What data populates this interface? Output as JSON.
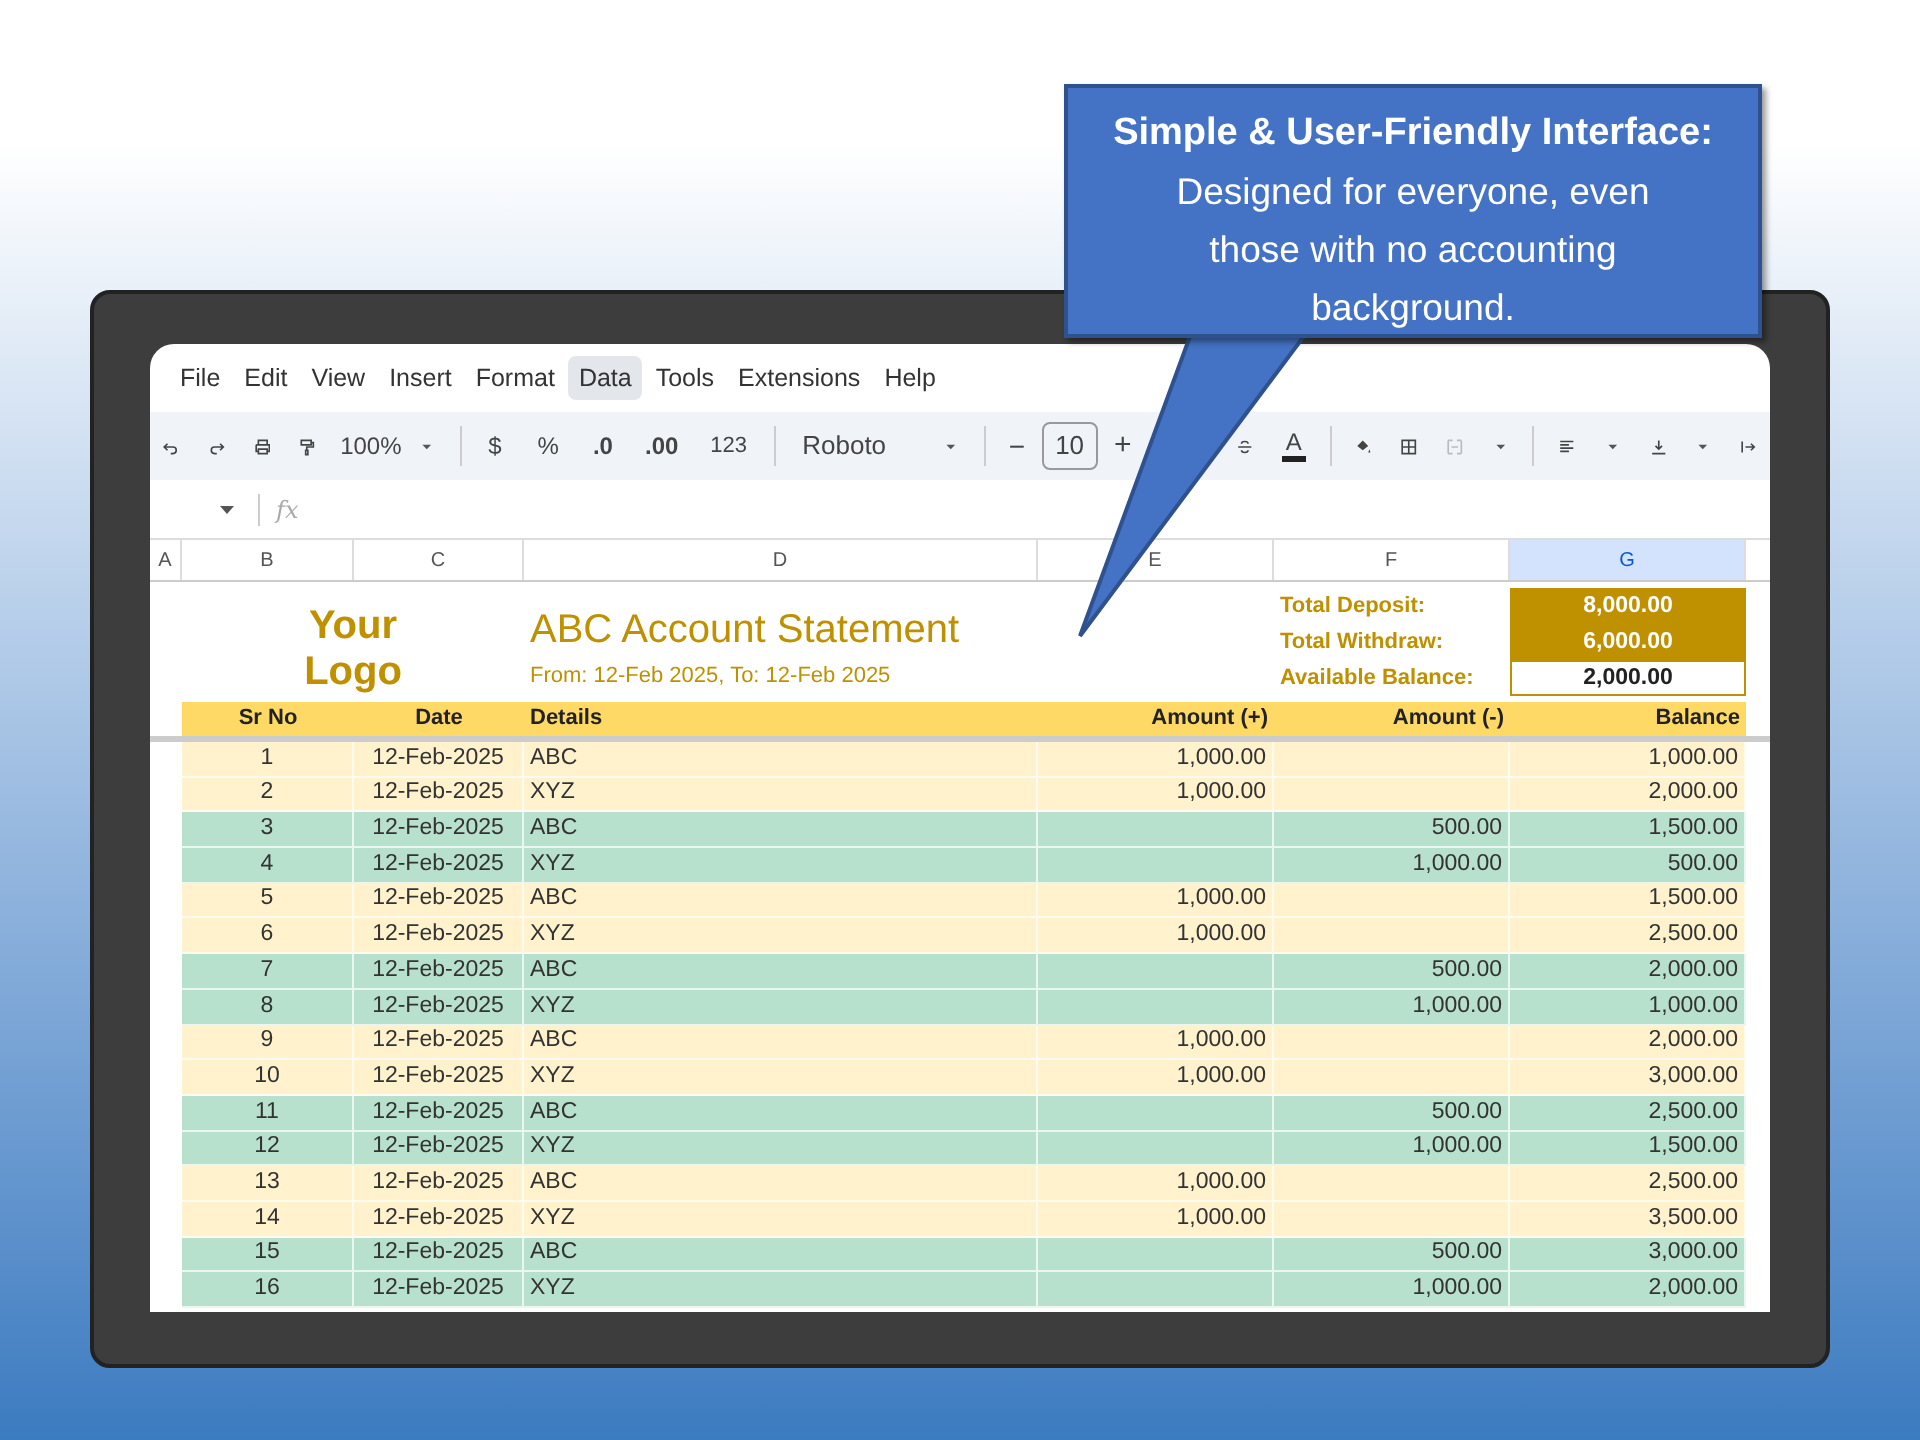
{
  "callout": {
    "title": "Simple & User-Friendly Interface:",
    "body": "Designed for everyone, even those with no accounting background."
  },
  "menu": [
    {
      "label": "File",
      "selected": false
    },
    {
      "label": "Edit",
      "selected": false
    },
    {
      "label": "View",
      "selected": false
    },
    {
      "label": "Insert",
      "selected": false
    },
    {
      "label": "Format",
      "selected": false
    },
    {
      "label": "Data",
      "selected": true
    },
    {
      "label": "Tools",
      "selected": false
    },
    {
      "label": "Extensions",
      "selected": false
    },
    {
      "label": "Help",
      "selected": false
    }
  ],
  "toolbar": {
    "zoom": "100%",
    "currency": "$",
    "percent": "%",
    "decrease_decimal": ".0",
    "increase_decimal": ".00",
    "number_format": "123",
    "font": "Roboto",
    "font_size_decrease": "−",
    "font_size": "10",
    "font_size_increase": "+",
    "text_color": "A"
  },
  "formula_bar": {
    "label": "fx"
  },
  "columns": [
    {
      "label": "A",
      "selected": false
    },
    {
      "label": "B",
      "selected": false
    },
    {
      "label": "C",
      "selected": false
    },
    {
      "label": "D",
      "selected": false
    },
    {
      "label": "E",
      "selected": false
    },
    {
      "label": "F",
      "selected": false
    },
    {
      "label": "G",
      "selected": true
    }
  ],
  "sheet": {
    "logo": "Your Logo",
    "title": "ABC Account Statement",
    "subtitle": "From: 12-Feb 2025, To: 12-Feb 2025",
    "summary": [
      {
        "label": "Total Deposit:",
        "value": "8,000.00",
        "highlighted": true
      },
      {
        "label": "Total Withdraw:",
        "value": "6,000.00",
        "highlighted": true
      },
      {
        "label": "Available Balance:",
        "value": "2,000.00",
        "highlighted": false
      }
    ],
    "headers": [
      "Sr No",
      "Date",
      "Details",
      "Amount (+)",
      "Amount (-)",
      "Balance"
    ],
    "rows": [
      {
        "sr": "1",
        "date": "12-Feb-2025",
        "details": "ABC",
        "plus": "1,000.00",
        "minus": "",
        "balance": "1,000.00",
        "color": "#fff2cc"
      },
      {
        "sr": "2",
        "date": "12-Feb-2025",
        "details": "XYZ",
        "plus": "1,000.00",
        "minus": "",
        "balance": "2,000.00",
        "color": "#fff2cc"
      },
      {
        "sr": "3",
        "date": "12-Feb-2025",
        "details": "ABC",
        "plus": "",
        "minus": "500.00",
        "balance": "1,500.00",
        "color": "#b7e1cd"
      },
      {
        "sr": "4",
        "date": "12-Feb-2025",
        "details": "XYZ",
        "plus": "",
        "minus": "1,000.00",
        "balance": "500.00",
        "color": "#b7e1cd"
      },
      {
        "sr": "5",
        "date": "12-Feb-2025",
        "details": "ABC",
        "plus": "1,000.00",
        "minus": "",
        "balance": "1,500.00",
        "color": "#fff2cc"
      },
      {
        "sr": "6",
        "date": "12-Feb-2025",
        "details": "XYZ",
        "plus": "1,000.00",
        "minus": "",
        "balance": "2,500.00",
        "color": "#fff2cc"
      },
      {
        "sr": "7",
        "date": "12-Feb-2025",
        "details": "ABC",
        "plus": "",
        "minus": "500.00",
        "balance": "2,000.00",
        "color": "#b7e1cd"
      },
      {
        "sr": "8",
        "date": "12-Feb-2025",
        "details": "XYZ",
        "plus": "",
        "minus": "1,000.00",
        "balance": "1,000.00",
        "color": "#b7e1cd"
      },
      {
        "sr": "9",
        "date": "12-Feb-2025",
        "details": "ABC",
        "plus": "1,000.00",
        "minus": "",
        "balance": "2,000.00",
        "color": "#fff2cc"
      },
      {
        "sr": "10",
        "date": "12-Feb-2025",
        "details": "XYZ",
        "plus": "1,000.00",
        "minus": "",
        "balance": "3,000.00",
        "color": "#fff2cc"
      },
      {
        "sr": "11",
        "date": "12-Feb-2025",
        "details": "ABC",
        "plus": "",
        "minus": "500.00",
        "balance": "2,500.00",
        "color": "#b7e1cd"
      },
      {
        "sr": "12",
        "date": "12-Feb-2025",
        "details": "XYZ",
        "plus": "",
        "minus": "1,000.00",
        "balance": "1,500.00",
        "color": "#b7e1cd"
      },
      {
        "sr": "13",
        "date": "12-Feb-2025",
        "details": "ABC",
        "plus": "1,000.00",
        "minus": "",
        "balance": "2,500.00",
        "color": "#fff2cc"
      },
      {
        "sr": "14",
        "date": "12-Feb-2025",
        "details": "XYZ",
        "plus": "1,000.00",
        "minus": "",
        "balance": "3,500.00",
        "color": "#fff2cc"
      },
      {
        "sr": "15",
        "date": "12-Feb-2025",
        "details": "ABC",
        "plus": "",
        "minus": "500.00",
        "balance": "3,000.00",
        "color": "#b7e1cd"
      },
      {
        "sr": "16",
        "date": "12-Feb-2025",
        "details": "XYZ",
        "plus": "",
        "minus": "1,000.00",
        "balance": "2,000.00",
        "color": "#b7e1cd"
      }
    ]
  }
}
